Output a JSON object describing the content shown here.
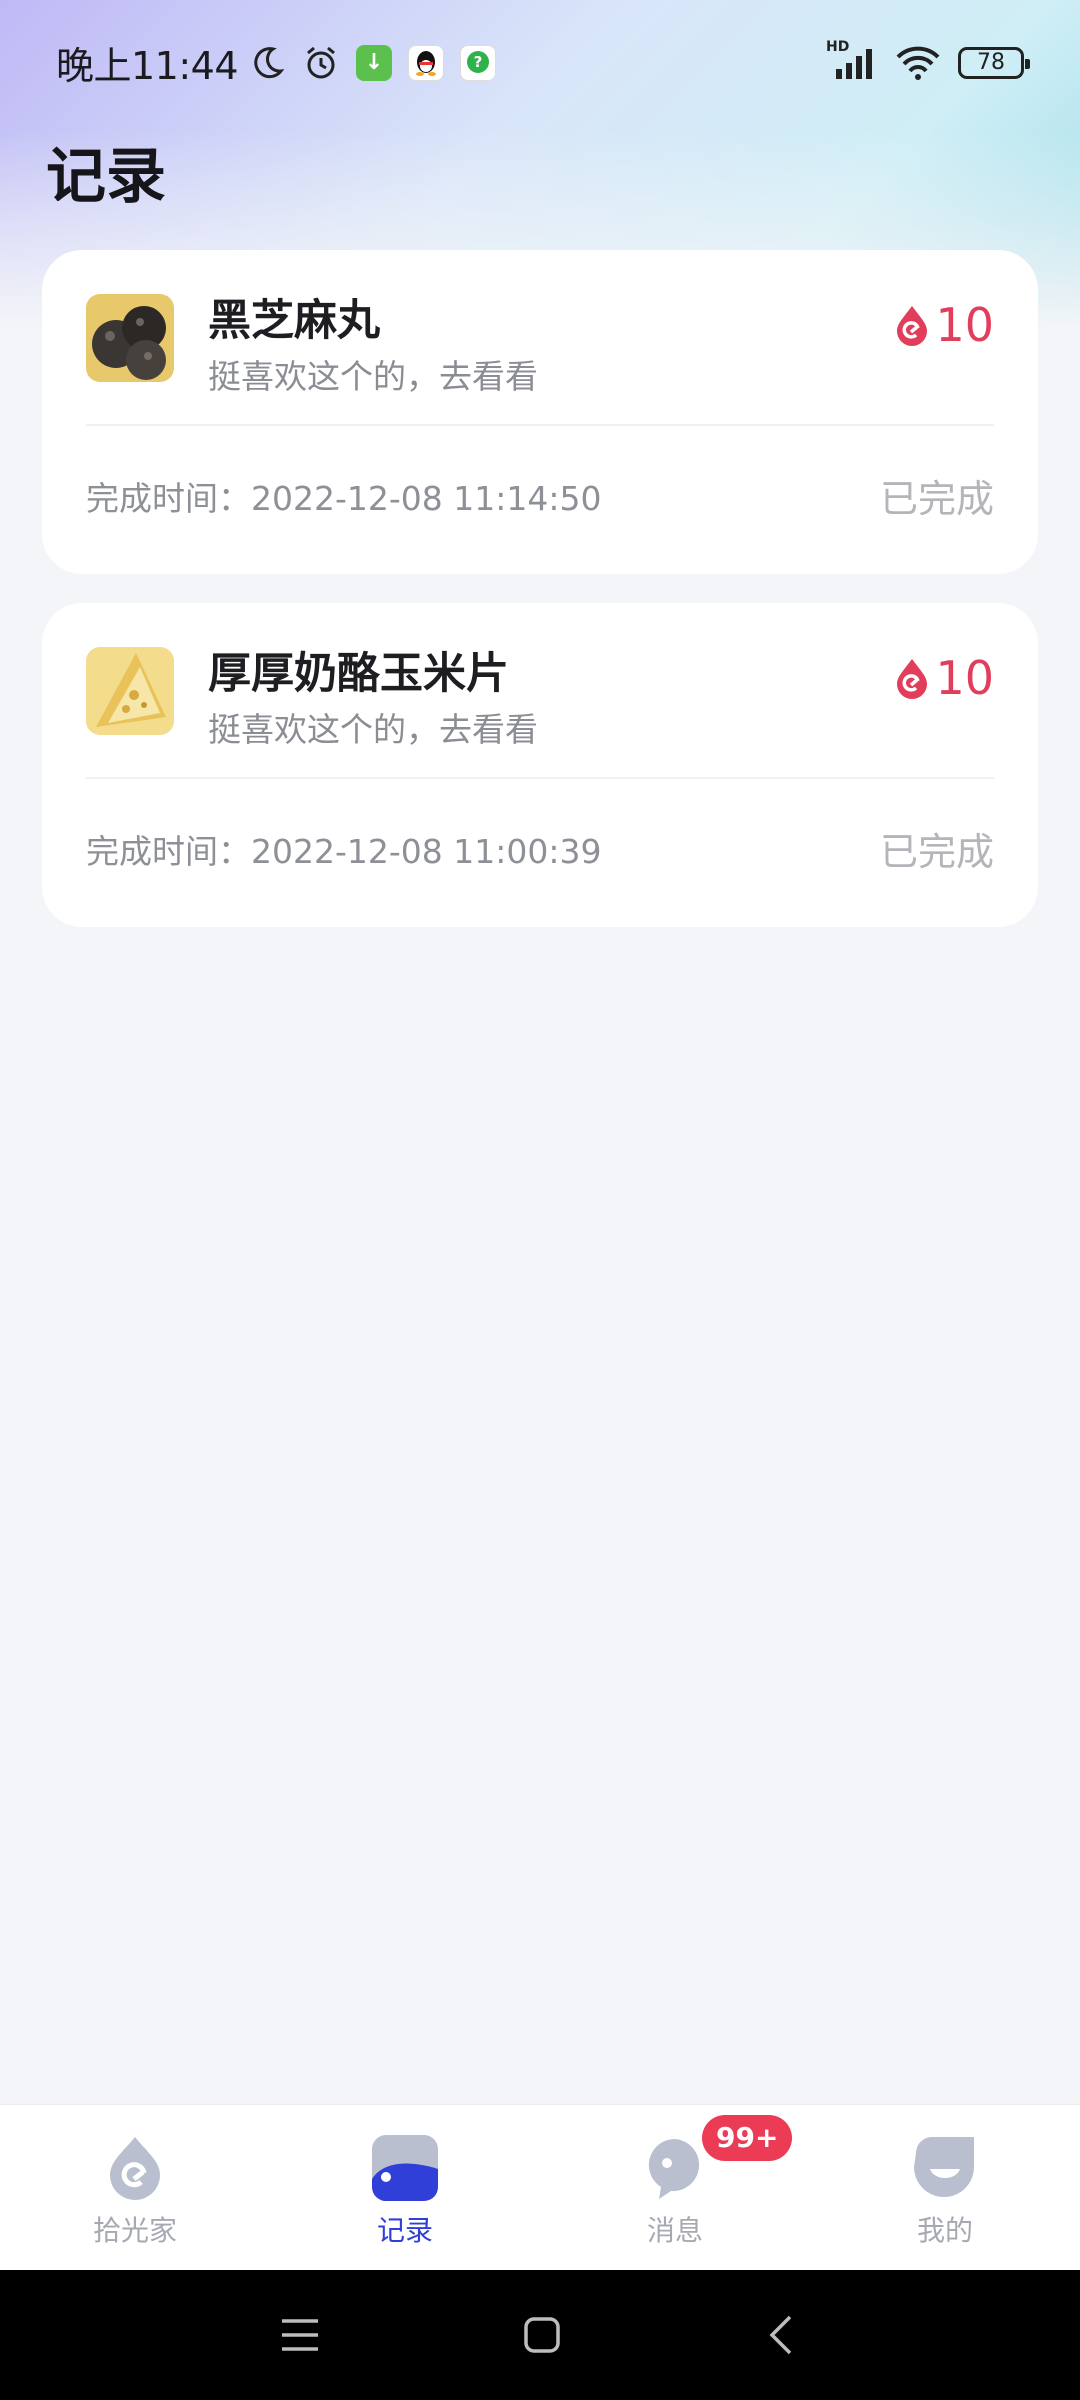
{
  "status_bar": {
    "time": "晚上11:44",
    "battery": "78",
    "network_label": "HD"
  },
  "page": {
    "title": "记录"
  },
  "records": [
    {
      "name": "黑芝麻丸",
      "description": "挺喜欢这个的，去看看",
      "points": "10",
      "time_label": "完成时间：",
      "time": "2022-12-08 11:14:50",
      "status": "已完成",
      "thumb_icon": "black-sesame-ball-image"
    },
    {
      "name": "厚厚奶酪玉米片",
      "description": "挺喜欢这个的，去看看",
      "points": "10",
      "time_label": "完成时间：",
      "time": "2022-12-08 11:00:39",
      "status": "已完成",
      "thumb_icon": "cheese-corn-chips-image"
    }
  ],
  "bottom_nav": {
    "items": [
      {
        "label": "拾光家",
        "icon": "drop-icon"
      },
      {
        "label": "记录",
        "icon": "record-icon"
      },
      {
        "label": "消息",
        "icon": "message-icon",
        "badge": "99+"
      },
      {
        "label": "我的",
        "icon": "profile-icon"
      }
    ],
    "active_index": 1
  },
  "colors": {
    "accent": "#2f3fd8",
    "points": "#e23d5b",
    "badge": "#ec3b55"
  }
}
